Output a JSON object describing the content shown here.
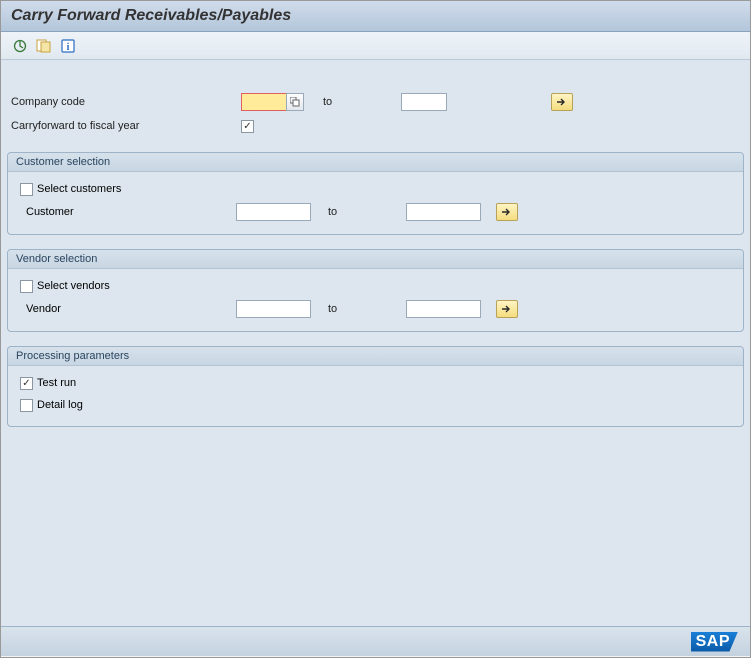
{
  "title": "Carry Forward Receivables/Payables",
  "toolbar_icons": [
    "execute-icon",
    "variant-icon",
    "info-icon"
  ],
  "fields": {
    "company_code_label": "Company code",
    "company_code_from": "",
    "company_code_to": "",
    "to_label": "to",
    "fiscal_year_label": "Carryforward to fiscal year",
    "fiscal_year_checked": true
  },
  "customer_section": {
    "title": "Customer selection",
    "select_label": "Select customers",
    "select_checked": false,
    "field_label": "Customer",
    "from": "",
    "to": "",
    "to_label": "to"
  },
  "vendor_section": {
    "title": "Vendor selection",
    "select_label": "Select vendors",
    "select_checked": false,
    "field_label": "Vendor",
    "from": "",
    "to": "",
    "to_label": "to"
  },
  "processing_section": {
    "title": "Processing parameters",
    "test_run_label": "Test run",
    "test_run_checked": true,
    "detail_log_label": "Detail log",
    "detail_log_checked": false
  },
  "footer_logo": "SAP"
}
